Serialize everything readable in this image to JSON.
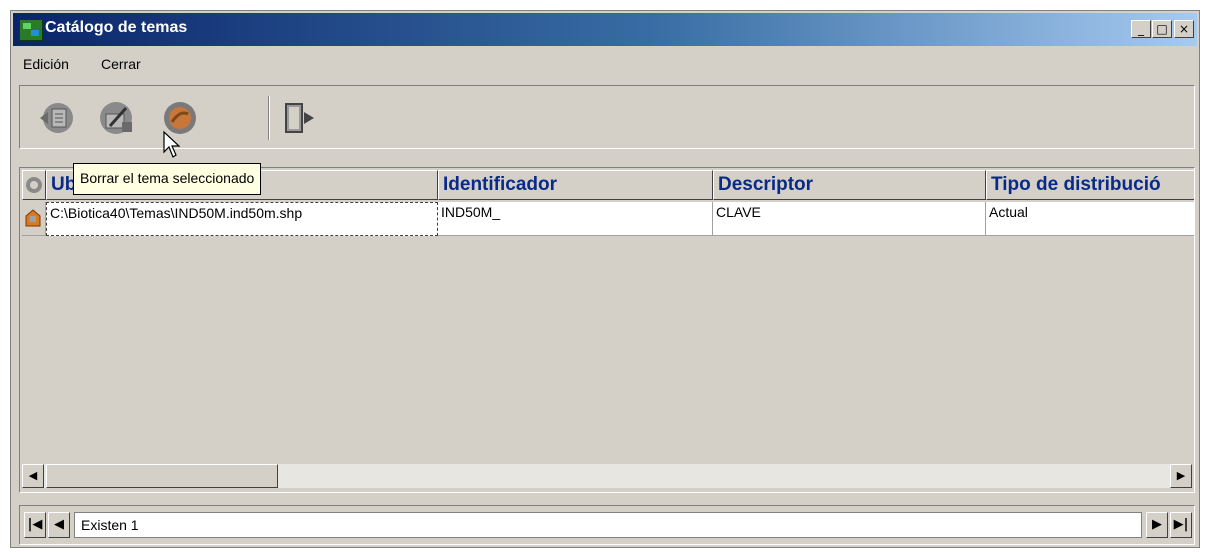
{
  "window": {
    "title": "Catálogo de temas",
    "controls": {
      "minimize": "_",
      "maximize": "□",
      "close": "×"
    }
  },
  "menu": {
    "items": [
      "Edición",
      "Cerrar"
    ]
  },
  "toolbar": {
    "buttons": [
      {
        "icon": "add-theme-icon",
        "tooltip": ""
      },
      {
        "icon": "edit-theme-icon",
        "tooltip": ""
      },
      {
        "icon": "delete-theme-icon",
        "tooltip": "Borrar el tema seleccionado"
      },
      {
        "icon": "exit-door-icon",
        "tooltip": ""
      }
    ]
  },
  "tooltip": {
    "text": "Borrar el tema seleccionado"
  },
  "grid": {
    "columns": [
      "Ubicación",
      "Identificador",
      "Descriptor",
      "Tipo de distribució"
    ],
    "visible_first_header": "Ub",
    "rows": [
      {
        "ubicacion": "C:\\Biotica40\\Temas\\IND50M.ind50m.shp",
        "identificador": "IND50M_",
        "descriptor": "CLAVE",
        "tipo": "Actual"
      }
    ]
  },
  "navigator": {
    "status": "Existen 1"
  },
  "colors": {
    "titlebar_start": "#0a246a",
    "titlebar_end": "#a6caf0",
    "header_text": "#0a2a8a",
    "tooltip_bg": "#ffffe1",
    "face": "#d4d0c8"
  }
}
